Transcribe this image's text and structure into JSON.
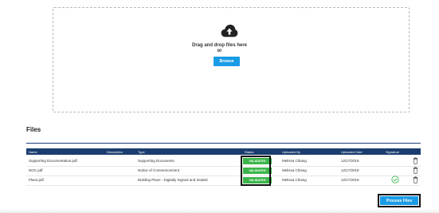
{
  "upload": {
    "drag_text": "Drag and drop files here",
    "or_text": "or",
    "browse_label": "Browse"
  },
  "files": {
    "title": "Files",
    "columns": [
      "Name",
      "Description",
      "Type",
      "Status",
      "Uploaded By",
      "Uploaded Date",
      "Signature"
    ],
    "rows": [
      {
        "name": "Supporting Documentation.pdf",
        "description": "",
        "type": "Supporting Documents",
        "status": "VALIDATED",
        "uploaded_by": "Melissa Chiang",
        "uploaded_date": "12/17/2019",
        "signed": false
      },
      {
        "name": "NOC.pdf",
        "description": "",
        "type": "Notice of Commencement",
        "status": "VALIDATED",
        "uploaded_by": "Melissa Chiang",
        "uploaded_date": "12/17/2019",
        "signed": false
      },
      {
        "name": "Plans.pdf",
        "description": "",
        "type": "Building Plans - Digitally Signed and Sealed",
        "status": "VALIDATED",
        "uploaded_by": "Melissa Chiang",
        "uploaded_date": "12/17/2019",
        "signed": true
      }
    ]
  },
  "actions": {
    "process_label": "Process Files"
  },
  "colors": {
    "accent": "#1a9be6",
    "header": "#1b3d6e",
    "validated": "#3bb54a"
  },
  "icons": {
    "upload": "cloud-upload-icon",
    "delete": "trash-icon",
    "signed": "check-circle-icon"
  }
}
